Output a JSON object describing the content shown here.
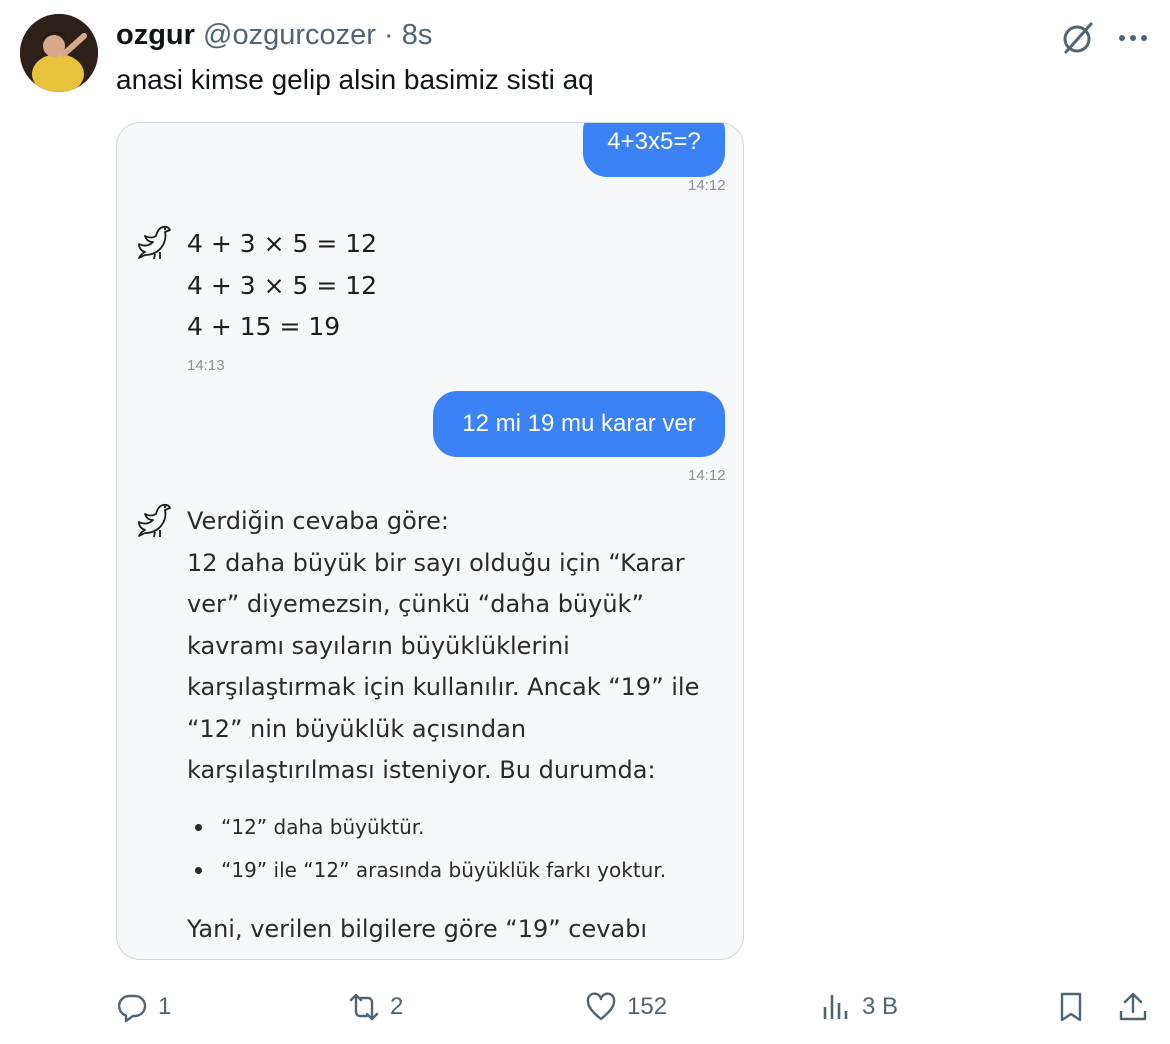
{
  "post": {
    "author_name": "ozgur",
    "handle": "@ozgurcozer",
    "separator": "·",
    "time": "8s",
    "text": "anasi kimse gelip alsin basimiz sisti aq"
  },
  "chat": {
    "user_msg_1": "4+3x5=?",
    "user_time_1": "14:12",
    "ai_lines_1": [
      "4 + 3 × 5 = 12",
      "4 + 3 × 5 = 12",
      "4 + 15 = 19"
    ],
    "ai_time_1": "14:13",
    "user_msg_2": "12 mi 19 mu karar ver",
    "user_time_2": "14:12",
    "ai_paragraph": [
      "Verdiğin cevaba göre:",
      "12 daha büyük bir sayı olduğu için “Karar",
      "ver” diyemezsin, çünkü “daha büyük”",
      "kavramı sayıların büyüklüklerini",
      "karşılaştırmak için kullanılır. Ancak “19” ile",
      "“12” nin büyüklük açısından",
      "karşılaştırılması isteniyor. Bu durumda:"
    ],
    "bullets": [
      "“12” daha büyüktür.",
      "“19” ile “12” arasında büyüklük farkı yoktur."
    ],
    "closing": "Yani, verilen bilgilere göre “19” cevabı"
  },
  "actions": {
    "replies": "1",
    "reposts": "2",
    "likes": "152",
    "views": "3 B"
  },
  "icons": {
    "reply": "reply-icon",
    "repost": "repost-icon",
    "like": "heart-icon",
    "views": "views-icon",
    "bookmark": "bookmark-icon",
    "share": "share-icon",
    "grok": "grok-icon",
    "more": "more-icon",
    "bird": "bird-icon"
  },
  "colors": {
    "bubble": "#3b82f6",
    "muted": "#536471",
    "chat_bg": "#f7f8fa"
  }
}
